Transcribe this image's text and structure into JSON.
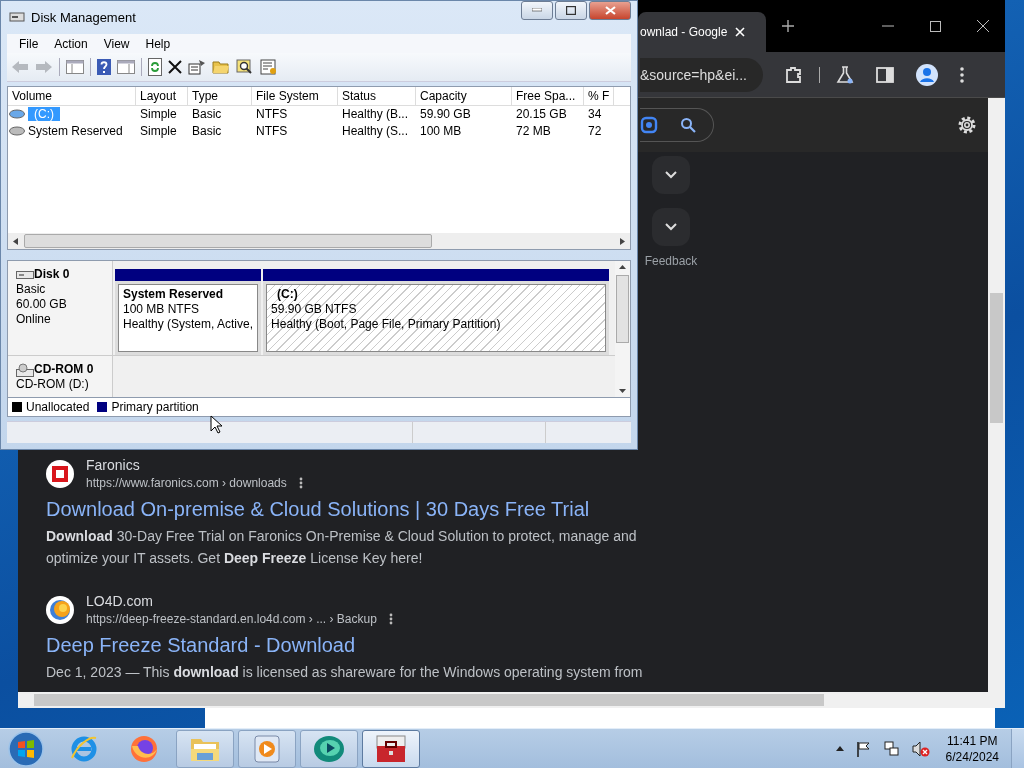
{
  "browser": {
    "tab": {
      "title": "ownlad - Google"
    },
    "address": "&source=hp&ei...",
    "side_link": "Feedback",
    "results": [
      {
        "site": "Faronics",
        "url": "https://www.faronics.com › downloads",
        "title": "Download On-premise & Cloud Solutions | 30 Days Free Trial",
        "snippet": "**Download** 30-Day Free Trial on Faronics On-Premise & Cloud Solution to protect, manage and optimize your IT assets. Get **Deep Freeze** License Key here!",
        "kind": "square"
      },
      {
        "site": "LO4D.com",
        "url": "https://deep-freeze-standard.en.lo4d.com › ... › Backup",
        "title": "Deep Freeze Standard - Download",
        "snippet": "Dec 1, 2023 — This **download** is licensed as shareware for the Windows operating system from",
        "kind": "ball"
      }
    ]
  },
  "window": {
    "title": "Disk Management"
  },
  "menu": [
    "File",
    "Action",
    "View",
    "Help"
  ],
  "table": {
    "columns": [
      "Volume",
      "Layout",
      "Type",
      "File System",
      "Status",
      "Capacity",
      "Free Spa...",
      "% F"
    ],
    "rows": [
      {
        "cells": [
          "(C:)",
          "Simple",
          "Basic",
          "NTFS",
          "Healthy (B...",
          "59.90 GB",
          "20.15 GB",
          "34"
        ],
        "selected": true
      },
      {
        "cells": [
          "System Reserved",
          "Simple",
          "Basic",
          "NTFS",
          "Healthy (S...",
          "100 MB",
          "72 MB",
          "72"
        ],
        "selected": false
      }
    ]
  },
  "disks": [
    {
      "name": "Disk 0",
      "lines": [
        "Basic",
        "60.00 GB",
        "Online"
      ],
      "kind": "hdd",
      "partitions": [
        {
          "name": "System Reserved",
          "size": "100 MB NTFS",
          "status": "Healthy (System, Active,",
          "selected": false
        },
        {
          "name": "(C:)",
          "size": "59.90 GB NTFS",
          "status": "Healthy (Boot, Page File, Primary Partition)",
          "selected": true
        }
      ]
    },
    {
      "name": "CD-ROM 0",
      "lines": [
        "CD-ROM (D:)"
      ],
      "kind": "cdrom"
    }
  ],
  "legend": [
    {
      "label": "Unallocated",
      "color": "#000000"
    },
    {
      "label": "Primary partition",
      "color": "#000080"
    }
  ],
  "taskbar": {
    "apps": [
      {
        "selected": false
      },
      {
        "selected": false
      },
      {
        "selected": false
      },
      {
        "selected": false
      },
      {
        "selected": false
      },
      {
        "selected": true
      }
    ],
    "time": "11:41 PM",
    "date": "6/24/2024"
  }
}
